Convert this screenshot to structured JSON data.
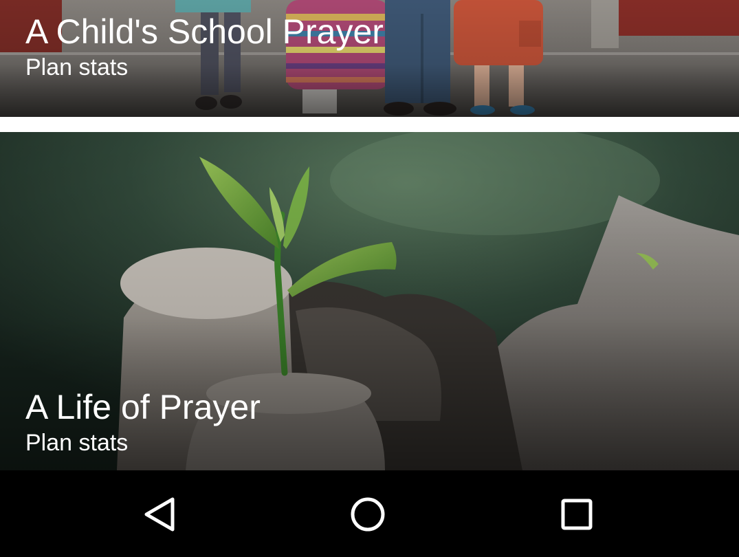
{
  "plans": [
    {
      "title": "A Child's School Prayer",
      "stats_label": "Plan stats",
      "image": "children-with-backpacks-photo"
    },
    {
      "title": "A Life of Prayer",
      "stats_label": "Plan stats",
      "image": "seedling-sprout-photo"
    }
  ],
  "navbar": {
    "back_icon": "back-triangle-icon",
    "home_icon": "home-circle-icon",
    "recents_icon": "recents-square-icon",
    "background": "#000000",
    "icon_color": "#ffffff"
  }
}
